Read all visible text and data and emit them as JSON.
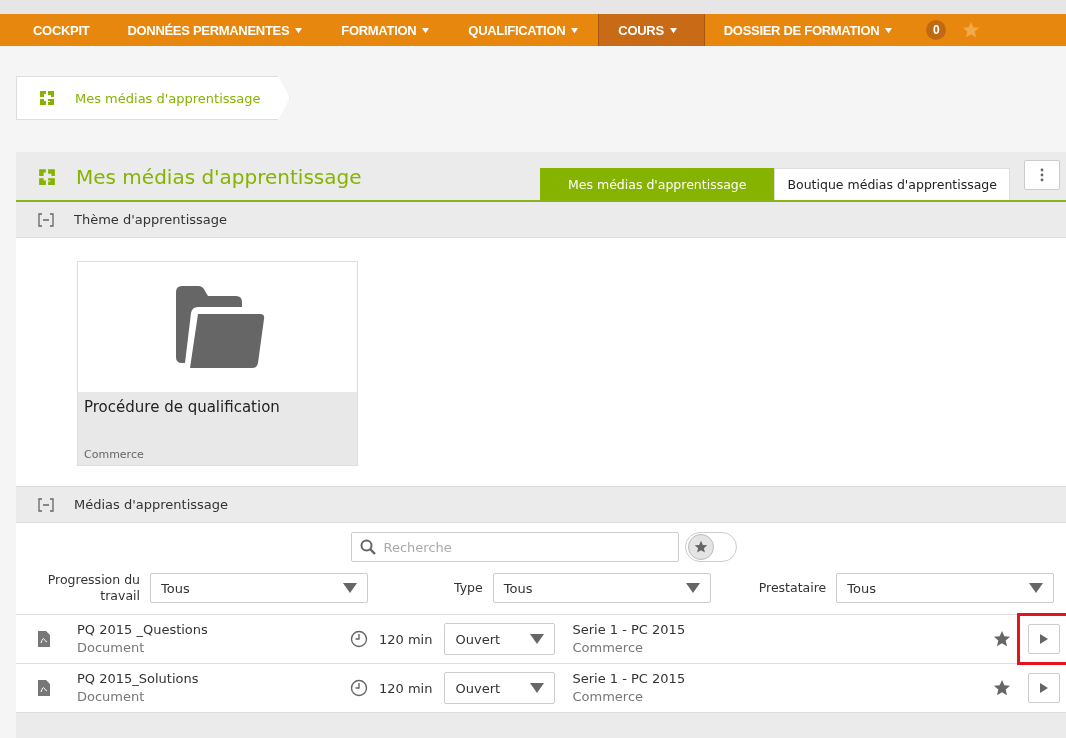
{
  "nav": {
    "items": [
      {
        "label": "COCKPIT",
        "has_menu": false,
        "selected": false
      },
      {
        "label": "DONNÉES PERMANENTES",
        "has_menu": true,
        "selected": false
      },
      {
        "label": "FORMATION",
        "has_menu": true,
        "selected": false
      },
      {
        "label": "QUALIFICATION",
        "has_menu": true,
        "selected": false
      },
      {
        "label": "COURS",
        "has_menu": true,
        "selected": true
      },
      {
        "label": "DOSSIER DE FORMATION",
        "has_menu": true,
        "selected": false
      }
    ],
    "badge": "0"
  },
  "breadcrumb": "Mes médias d'apprentissage",
  "panel": {
    "title": "Mes médias d'apprentissage",
    "tabs": [
      {
        "label": "Mes médias d'apprentissage",
        "selected": true
      },
      {
        "label": "Boutique médias d'apprentissage",
        "selected": false
      }
    ],
    "themes_section": {
      "title": "Thème d'apprentissage",
      "expanded": true,
      "cards": [
        {
          "title": "Procédure de qualification",
          "subtitle": "Commerce"
        }
      ]
    },
    "media_section": {
      "title": "Médias d'apprentissage",
      "expanded": true,
      "search": {
        "placeholder": "Recherche"
      },
      "favorites_toggle": {
        "on": false
      },
      "filters": [
        {
          "label": "Progression du travail",
          "value": "Tous"
        },
        {
          "label": "Type",
          "value": "Tous"
        },
        {
          "label": "Prestataire",
          "value": "Tous"
        }
      ],
      "rows": [
        {
          "name": "PQ 2015 _Questions",
          "type": "Document",
          "duration": "120 min",
          "status": "Ouvert",
          "series": "Serie 1 - PC 2015",
          "provider": "Commerce",
          "highlighted": true
        },
        {
          "name": "PQ 2015_Solutions",
          "type": "Document",
          "duration": "120 min",
          "status": "Ouvert",
          "series": "Serie 1 - PC 2015",
          "provider": "Commerce",
          "highlighted": false
        }
      ]
    }
  }
}
